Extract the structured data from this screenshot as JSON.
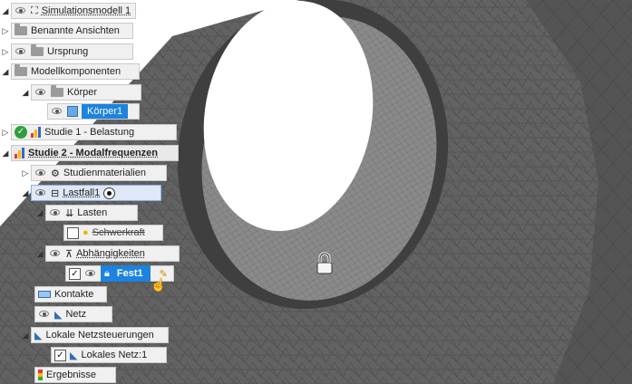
{
  "browser": {
    "root": {
      "label": "Simulationsmodell 1"
    },
    "named_views": {
      "label": "Benannte Ansichten"
    },
    "origin": {
      "label": "Ursprung"
    },
    "components": {
      "label": "Modellkomponenten"
    },
    "bodies": {
      "label": "Körper"
    },
    "body1": {
      "label": "Körper1"
    },
    "study1": {
      "label": "Studie 1 - Belastung"
    },
    "study2": {
      "label": "Studie 2 - Modalfrequenzen"
    },
    "materials": {
      "label": "Studienmaterialien"
    },
    "loadcase": {
      "label": "Lastfall1"
    },
    "loads": {
      "label": "Lasten"
    },
    "gravity": {
      "label": "Schwerkraft"
    },
    "constraints": {
      "label": "Abhängigkeiten"
    },
    "fixed": {
      "label": "Fest1"
    },
    "contacts": {
      "label": "Kontakte"
    },
    "mesh": {
      "label": "Netz"
    },
    "local_mesh": {
      "label": "Lokale Netzsteuerungen"
    },
    "local_mesh1": {
      "label": "Lokales Netz:1"
    },
    "results": {
      "label": "Ergebnisse"
    }
  },
  "colors": {
    "selected": "#1c83e0",
    "model": "#5d5d5d",
    "hole": "#ffffff"
  }
}
